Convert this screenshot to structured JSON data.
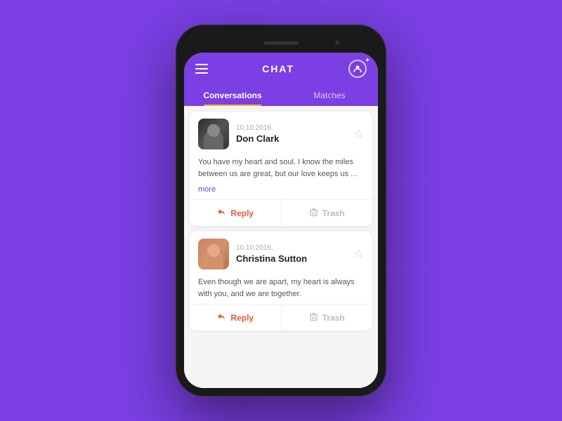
{
  "background_color": "#7b3fe4",
  "header": {
    "title": "CHAT",
    "menu_label": "menu",
    "profile_label": "profile"
  },
  "tabs": [
    {
      "id": "conversations",
      "label": "Conversations",
      "active": true
    },
    {
      "id": "matches",
      "label": "Matches",
      "active": false
    }
  ],
  "messages": [
    {
      "id": "msg1",
      "date": "10.10.2016.",
      "name": "Don Clark",
      "avatar_type": "don",
      "text": "You have my heart and soul. I know the miles between us are great, but our love keeps us ...",
      "more_label": "more",
      "reply_label": "Reply",
      "trash_label": "Trash"
    },
    {
      "id": "msg2",
      "date": "10.10.2016.",
      "name": "Christina Sutton",
      "avatar_type": "christina",
      "text": "Even though we are apart, my heart is always with you, and we are together.",
      "more_label": null,
      "reply_label": "Reply",
      "trash_label": "Trash"
    }
  ]
}
